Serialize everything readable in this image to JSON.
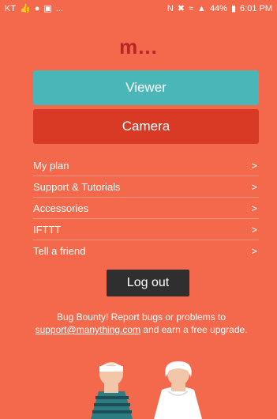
{
  "status_bar": {
    "carrier": "KT",
    "left_icons": [
      "thumbs-up-icon",
      "chat-icon",
      "gallery-icon"
    ],
    "overflow": "...",
    "battery": "44%",
    "time": "6:01 PM"
  },
  "app": {
    "logo": "m..."
  },
  "buttons": {
    "viewer": "Viewer",
    "camera": "Camera",
    "logout": "Log out"
  },
  "menu": [
    {
      "label": "My plan"
    },
    {
      "label": "Support & Tutorials"
    },
    {
      "label": "Accessories"
    },
    {
      "label": "IFTTT"
    },
    {
      "label": "Tell a friend"
    }
  ],
  "bounty": {
    "text_before": "Bug Bounty! Report bugs or problems to",
    "email": "support@manything.com",
    "text_after": "and earn a free upgrade."
  },
  "colors": {
    "background": "#f4694c",
    "viewer": "#4bb6b7",
    "camera": "#d93a25",
    "logout": "#2f2f2f",
    "logo": "#b8242a"
  }
}
